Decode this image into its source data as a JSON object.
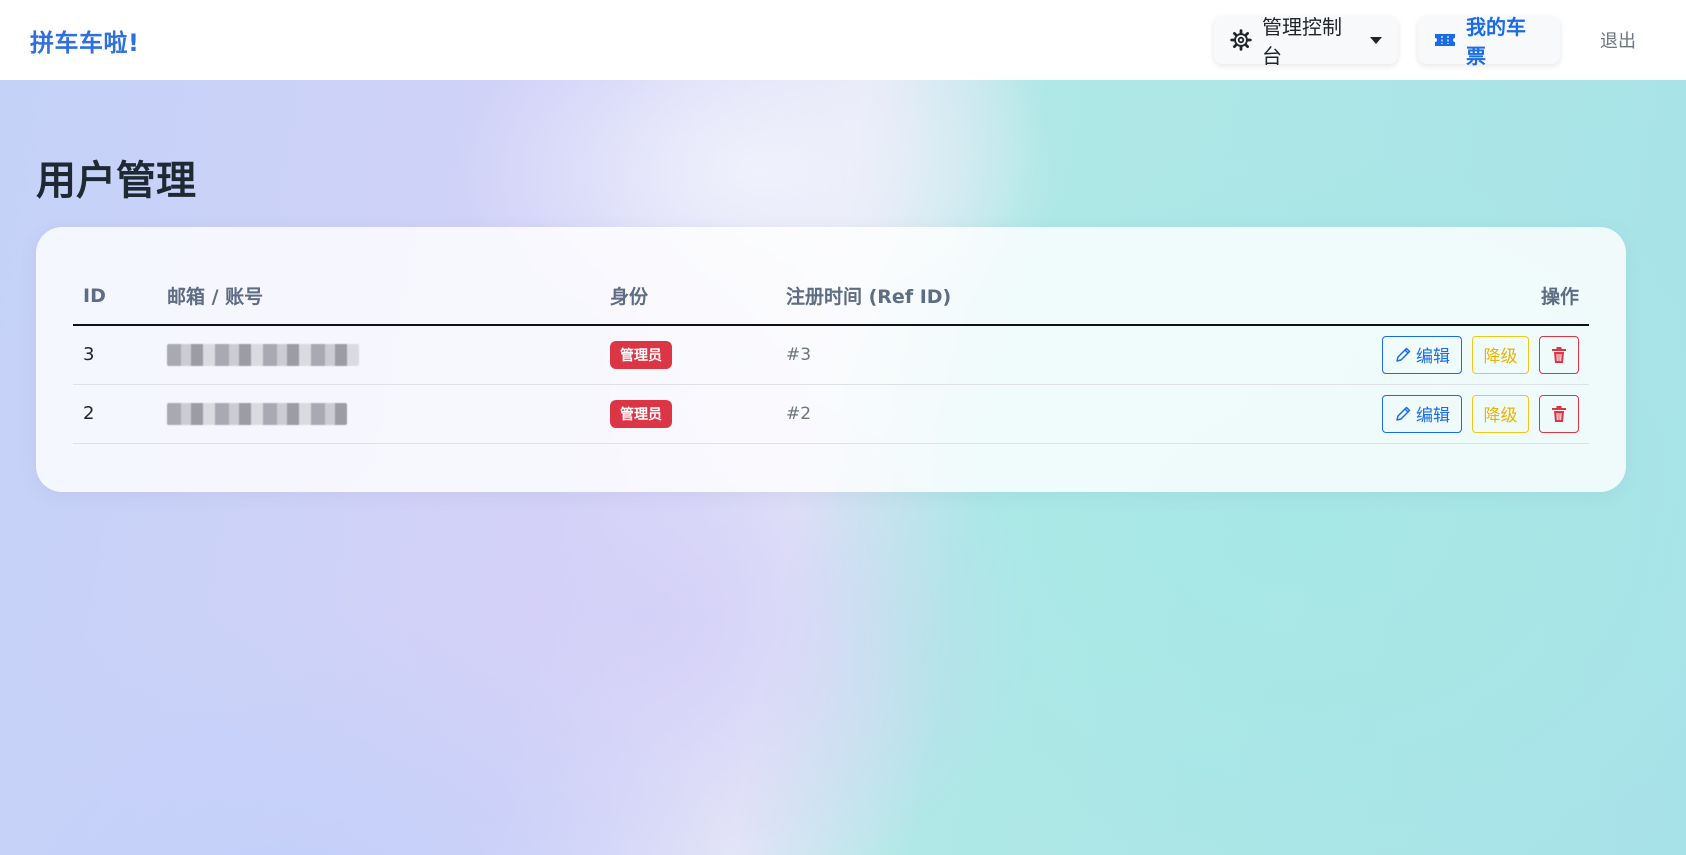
{
  "navbar": {
    "brand": "拼车车啦!",
    "admin_menu_label": "管理控制台",
    "tickets_label": "我的车票",
    "logout_label": "退出"
  },
  "page": {
    "title": "用户管理"
  },
  "table": {
    "headers": {
      "id": "ID",
      "email": "邮箱 / 账号",
      "role": "身份",
      "ref": "注册时间 (Ref ID)",
      "actions": "操作"
    },
    "rows": [
      {
        "id": "3",
        "role": "管理员",
        "ref": "#3"
      },
      {
        "id": "2",
        "role": "管理员",
        "ref": "#2"
      }
    ],
    "actions": {
      "edit_label": "编辑",
      "demote_label": "降级"
    }
  },
  "colors": {
    "brand": "#2f6fe0",
    "primary": "#1a6be6",
    "warning": "#f5c518",
    "danger": "#dc3545"
  },
  "icons": {
    "admin_menu": "gear-icon",
    "tickets": "ticket-icon",
    "edit": "pencil-icon",
    "delete": "trash-icon"
  }
}
